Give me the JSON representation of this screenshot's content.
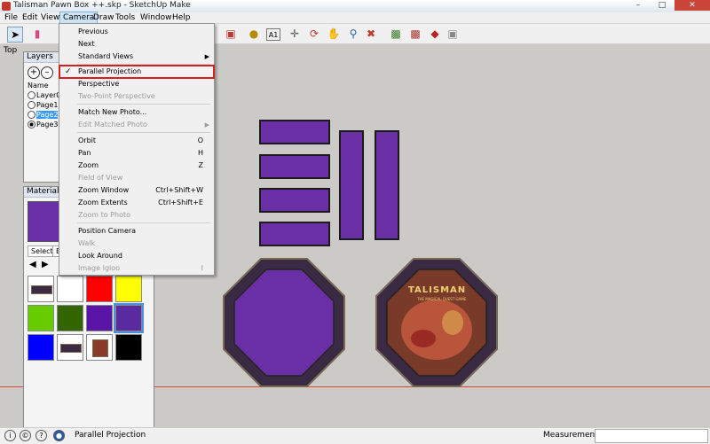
{
  "window": {
    "title": "Talisman Pawn Box ++.skp - SketchUp Make"
  },
  "menubar": [
    "File",
    "Edit",
    "View",
    "Camera",
    "Draw",
    "Tools",
    "Window",
    "Help"
  ],
  "camera_menu": [
    {
      "label": "Previous",
      "shortcut": "",
      "disabled": false
    },
    {
      "label": "Next",
      "shortcut": "",
      "disabled": false
    },
    {
      "label": "Standard Views",
      "shortcut": "",
      "submenu": true
    },
    {
      "label": "Parallel Projection",
      "checked": true,
      "highlight": true
    },
    {
      "label": "Perspective"
    },
    {
      "label": "Two-Point Perspective",
      "disabled": true
    },
    {
      "label": "Match New Photo..."
    },
    {
      "label": "Edit Matched Photo",
      "disabled": true,
      "submenu": true
    },
    {
      "label": "Orbit",
      "shortcut": "O"
    },
    {
      "label": "Pan",
      "shortcut": "H"
    },
    {
      "label": "Zoom",
      "shortcut": "Z"
    },
    {
      "label": "Field of View",
      "disabled": true
    },
    {
      "label": "Zoom Window",
      "shortcut": "Ctrl+Shift+W"
    },
    {
      "label": "Zoom Extents",
      "shortcut": "Ctrl+Shift+E"
    },
    {
      "label": "Zoom to Photo",
      "disabled": true
    },
    {
      "label": "Position Camera"
    },
    {
      "label": "Walk",
      "disabled": true
    },
    {
      "label": "Look Around"
    },
    {
      "label": "Image Igloo",
      "shortcut": "I",
      "disabled": true
    }
  ],
  "viewport": {
    "view_label": "Top"
  },
  "layers_panel": {
    "title": "Layers",
    "column_header": "Name",
    "layers": [
      {
        "name": "Layer0",
        "active": false
      },
      {
        "name": "Page1",
        "active": false
      },
      {
        "name": "Page2",
        "active": false,
        "selected": true
      },
      {
        "name": "Page3",
        "active": true
      }
    ]
  },
  "materials_panel": {
    "title": "Materials",
    "tabs": [
      "Select",
      "Ed"
    ],
    "swatch_colors": [
      "#ffffff",
      "#ffffff",
      "#ff0000",
      "#ffff00",
      "#66cc00",
      "#336600",
      "#5a14a8",
      "#5a2aa0",
      "#0000ff",
      "#3b2a44",
      "#8b3a2a",
      "#000000"
    ]
  },
  "statusbar": {
    "status": "Parallel Projection",
    "measurements_label": "Measurements"
  },
  "colors": {
    "purple": "#6a2fa4",
    "frame_dark": "#3b2a44",
    "frame_border": "#7a6a54"
  },
  "board": {
    "title_text": "TALISMAN",
    "subtitle_text": "THE MAGICAL QUEST GAME"
  }
}
